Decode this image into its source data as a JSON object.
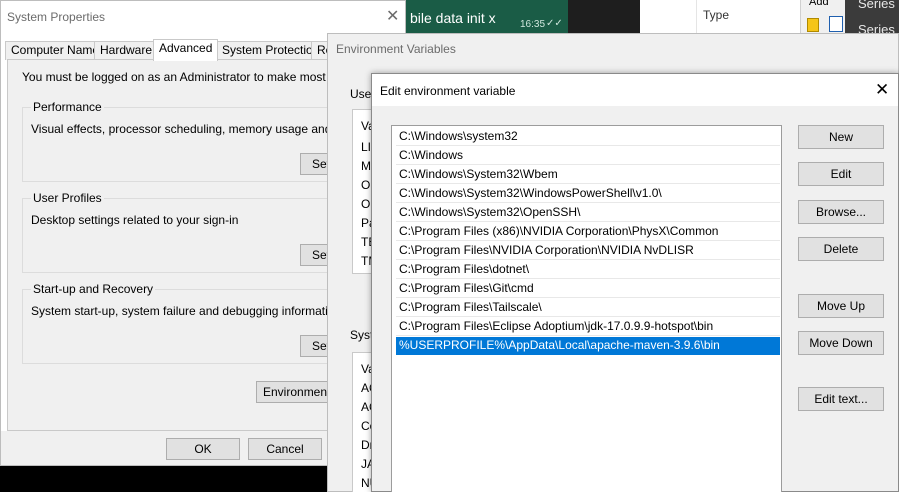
{
  "background": {
    "chat": {
      "message": "bile data init x",
      "time": "16:35",
      "ticks": "✓✓"
    },
    "explorer": {
      "column": "Type"
    },
    "excel": {
      "add_label": "Add"
    },
    "series": {
      "label1": "Series",
      "label2": "Series C"
    }
  },
  "system_properties": {
    "title": "System Properties",
    "close_glyph": "✕",
    "tabs": [
      "Computer Name",
      "Hardware",
      "Advanced",
      "System Protection",
      "Re"
    ],
    "note": "You must be logged on as an Administrator to make most of these",
    "performance": {
      "title": "Performance",
      "text": "Visual effects, processor scheduling, memory usage and virtual",
      "button": "Set"
    },
    "user_profiles": {
      "title": "User Profiles",
      "text": "Desktop settings related to your sign-in",
      "button": "Set"
    },
    "startup": {
      "title": "Start-up and Recovery",
      "text": "System start-up, system failure and debugging information",
      "button": "Set"
    },
    "env_button": "Environment V",
    "ok": "OK",
    "cancel": "Cancel"
  },
  "environment_variables": {
    "title": "Environment Variables",
    "user_section": "User",
    "user_rows": [
      "Va",
      "LIB",
      "Mi",
      "On",
      "On",
      "Pa",
      "TE",
      "TM"
    ],
    "system_section": "Syste",
    "system_rows": [
      "Va",
      "AC",
      "AC",
      "Co",
      "Dr",
      "JA",
      "NU"
    ]
  },
  "edit_dialog": {
    "title": "Edit environment variable",
    "close_glyph": "✕",
    "paths": [
      "C:\\Windows\\system32",
      "C:\\Windows",
      "C:\\Windows\\System32\\Wbem",
      "C:\\Windows\\System32\\WindowsPowerShell\\v1.0\\",
      "C:\\Windows\\System32\\OpenSSH\\",
      "C:\\Program Files (x86)\\NVIDIA Corporation\\PhysX\\Common",
      "C:\\Program Files\\NVIDIA Corporation\\NVIDIA NvDLISR",
      "C:\\Program Files\\dotnet\\",
      "C:\\Program Files\\Git\\cmd",
      "C:\\Program Files\\Tailscale\\",
      "C:\\Program Files\\Eclipse Adoptium\\jdk-17.0.9.9-hotspot\\bin",
      "%USERPROFILE%\\AppData\\Local\\apache-maven-3.9.6\\bin"
    ],
    "selected_index": 11,
    "buttons": {
      "new": "New",
      "edit": "Edit",
      "browse": "Browse...",
      "delete": "Delete",
      "move_up": "Move Up",
      "move_down": "Move Down",
      "edit_text": "Edit text..."
    },
    "selection_color": "#0078d7"
  }
}
